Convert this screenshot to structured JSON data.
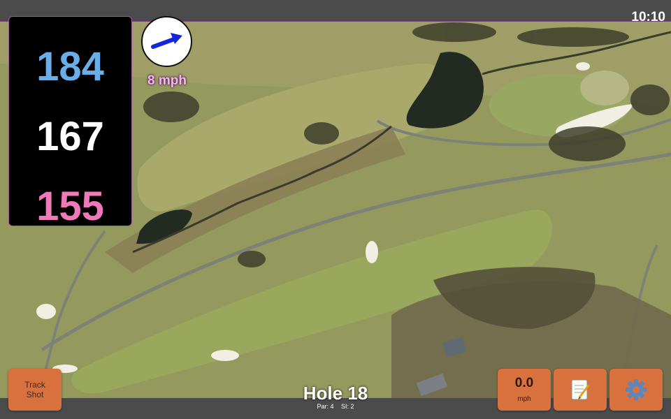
{
  "status": {
    "time": "10:10"
  },
  "distances": {
    "back": "184",
    "middle": "167",
    "front": "155"
  },
  "wind": {
    "arrow_icon": "wind-direction-arrow-icon",
    "speed_label": "8 mph"
  },
  "hole": {
    "title": "Hole 18",
    "par": "Par: 4",
    "stroke_index": "SI: 2"
  },
  "buttons": {
    "track_shot": "Track\nShot",
    "wind_value": "0.0",
    "wind_unit": "mph",
    "notes_icon": "notepad-icon",
    "settings_icon": "gear-icon"
  },
  "colors": {
    "back_distance": "#6aaee8",
    "middle_distance": "#ffffff",
    "front_distance": "#f07ab8",
    "button_bg": "#d9713f",
    "wind_label": "#f3b6f0"
  }
}
